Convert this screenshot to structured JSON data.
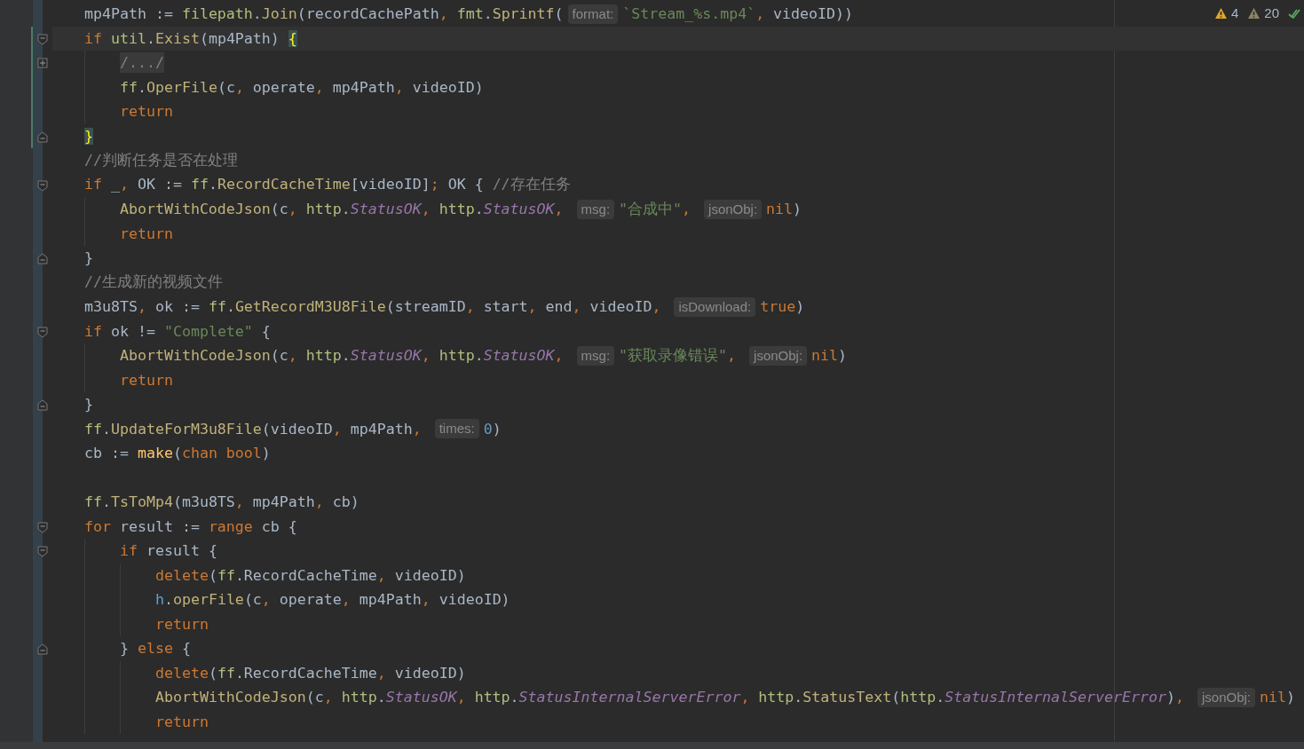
{
  "inspections": {
    "warnings": "4",
    "weak_warnings": "20",
    "ok": true
  },
  "lines": [
    {
      "current": false,
      "changed": false,
      "tokens": [
        {
          "kind": "id",
          "text": "mp4Path := "
        },
        {
          "kind": "pkg",
          "text": "filepath"
        },
        {
          "kind": "id",
          "text": "."
        },
        {
          "kind": "fn",
          "text": "Join"
        },
        {
          "kind": "id",
          "text": "(recordCachePath"
        },
        {
          "kind": "p",
          "text": ", "
        },
        {
          "kind": "pkg",
          "text": "fmt"
        },
        {
          "kind": "id",
          "text": "."
        },
        {
          "kind": "fn",
          "text": "Sprintf"
        },
        {
          "kind": "id",
          "text": "("
        },
        {
          "kind": "hint",
          "text": "format:"
        },
        {
          "kind": "str",
          "text": "`Stream_%s.mp4`"
        },
        {
          "kind": "p",
          "text": ", "
        },
        {
          "kind": "id",
          "text": "videoID))"
        }
      ]
    },
    {
      "current": true,
      "changed": true,
      "fold_marker": {
        "kind": "start"
      },
      "tokens": [
        {
          "kind": "kw",
          "text": "if "
        },
        {
          "kind": "pkg",
          "text": "util"
        },
        {
          "kind": "id",
          "text": "."
        },
        {
          "kind": "fn",
          "text": "Exist"
        },
        {
          "kind": "id",
          "text": "(mp4Path) "
        },
        {
          "kind": "brace",
          "text": "{"
        }
      ]
    },
    {
      "current": false,
      "changed": true,
      "fold_marker": {
        "kind": "collapsed"
      },
      "tokens": [
        {
          "kind": "folded",
          "text": "    /.../"
        }
      ]
    },
    {
      "current": false,
      "changed": true,
      "tokens": [
        {
          "kind": "pkg",
          "text": "    ff"
        },
        {
          "kind": "id",
          "text": "."
        },
        {
          "kind": "fn",
          "text": "OperFile"
        },
        {
          "kind": "id",
          "text": "(c"
        },
        {
          "kind": "p",
          "text": ", "
        },
        {
          "kind": "id",
          "text": "operate"
        },
        {
          "kind": "p",
          "text": ", "
        },
        {
          "kind": "id",
          "text": "mp4Path"
        },
        {
          "kind": "p",
          "text": ", "
        },
        {
          "kind": "id",
          "text": "videoID)"
        }
      ]
    },
    {
      "current": false,
      "changed": true,
      "tokens": [
        {
          "kind": "kw",
          "text": "    return"
        }
      ]
    },
    {
      "current": false,
      "changed": true,
      "fold_marker": {
        "kind": "end"
      },
      "tokens": [
        {
          "kind": "brace",
          "text": "}"
        }
      ]
    },
    {
      "current": false,
      "changed": false,
      "tokens": [
        {
          "kind": "cm",
          "text": "//判断任务是否在处理"
        }
      ]
    },
    {
      "current": false,
      "changed": false,
      "fold_marker": {
        "kind": "start"
      },
      "tokens": [
        {
          "kind": "kw",
          "text": "if "
        },
        {
          "kind": "id",
          "text": "_"
        },
        {
          "kind": "p",
          "text": ", "
        },
        {
          "kind": "id",
          "text": "OK := "
        },
        {
          "kind": "pkg",
          "text": "ff"
        },
        {
          "kind": "id",
          "text": "."
        },
        {
          "kind": "fn",
          "text": "RecordCacheTime"
        },
        {
          "kind": "id",
          "text": "[videoID]"
        },
        {
          "kind": "p",
          "text": "; "
        },
        {
          "kind": "id",
          "text": "OK { "
        },
        {
          "kind": "cm",
          "text": "//存在任务"
        }
      ]
    },
    {
      "current": false,
      "changed": false,
      "tokens": [
        {
          "kind": "fn",
          "text": "    AbortWithCodeJson"
        },
        {
          "kind": "id",
          "text": "(c"
        },
        {
          "kind": "p",
          "text": ", "
        },
        {
          "kind": "pkg",
          "text": "http"
        },
        {
          "kind": "id",
          "text": "."
        },
        {
          "kind": "const",
          "text": "StatusOK"
        },
        {
          "kind": "p",
          "text": ", "
        },
        {
          "kind": "pkg",
          "text": "http"
        },
        {
          "kind": "id",
          "text": "."
        },
        {
          "kind": "const",
          "text": "StatusOK"
        },
        {
          "kind": "p",
          "text": ", "
        },
        {
          "kind": "hint",
          "text": "msg:"
        },
        {
          "kind": "str",
          "text": "\"合成中\""
        },
        {
          "kind": "p",
          "text": ", "
        },
        {
          "kind": "hint",
          "text": "jsonObj:"
        },
        {
          "kind": "kw",
          "text": "nil"
        },
        {
          "kind": "id",
          "text": ")"
        }
      ]
    },
    {
      "current": false,
      "changed": false,
      "tokens": [
        {
          "kind": "kw",
          "text": "    return"
        }
      ]
    },
    {
      "current": false,
      "changed": false,
      "fold_marker": {
        "kind": "end"
      },
      "tokens": [
        {
          "kind": "id",
          "text": "}"
        }
      ]
    },
    {
      "current": false,
      "changed": false,
      "tokens": [
        {
          "kind": "cm",
          "text": "//生成新的视频文件"
        }
      ]
    },
    {
      "current": false,
      "changed": false,
      "tokens": [
        {
          "kind": "id",
          "text": "m3u8TS"
        },
        {
          "kind": "p",
          "text": ", "
        },
        {
          "kind": "id",
          "text": "ok := "
        },
        {
          "kind": "pkg",
          "text": "ff"
        },
        {
          "kind": "id",
          "text": "."
        },
        {
          "kind": "fn",
          "text": "GetRecordM3U8File"
        },
        {
          "kind": "id",
          "text": "(streamID"
        },
        {
          "kind": "p",
          "text": ", "
        },
        {
          "kind": "id",
          "text": "start"
        },
        {
          "kind": "p",
          "text": ", "
        },
        {
          "kind": "id",
          "text": "end"
        },
        {
          "kind": "p",
          "text": ", "
        },
        {
          "kind": "id",
          "text": "videoID"
        },
        {
          "kind": "p",
          "text": ", "
        },
        {
          "kind": "hint",
          "text": "isDownload:"
        },
        {
          "kind": "kw",
          "text": "true"
        },
        {
          "kind": "id",
          "text": ")"
        }
      ]
    },
    {
      "current": false,
      "changed": false,
      "fold_marker": {
        "kind": "start"
      },
      "tokens": [
        {
          "kind": "kw",
          "text": "if "
        },
        {
          "kind": "id",
          "text": "ok != "
        },
        {
          "kind": "str",
          "text": "\"Complete\""
        },
        {
          "kind": "id",
          "text": " {"
        }
      ]
    },
    {
      "current": false,
      "changed": false,
      "tokens": [
        {
          "kind": "fn",
          "text": "    AbortWithCodeJson"
        },
        {
          "kind": "id",
          "text": "(c"
        },
        {
          "kind": "p",
          "text": ", "
        },
        {
          "kind": "pkg",
          "text": "http"
        },
        {
          "kind": "id",
          "text": "."
        },
        {
          "kind": "const",
          "text": "StatusOK"
        },
        {
          "kind": "p",
          "text": ", "
        },
        {
          "kind": "pkg",
          "text": "http"
        },
        {
          "kind": "id",
          "text": "."
        },
        {
          "kind": "const",
          "text": "StatusOK"
        },
        {
          "kind": "p",
          "text": ", "
        },
        {
          "kind": "hint",
          "text": "msg:"
        },
        {
          "kind": "str",
          "text": "\"获取录像错误\""
        },
        {
          "kind": "p",
          "text": ", "
        },
        {
          "kind": "hint",
          "text": "jsonObj:"
        },
        {
          "kind": "kw",
          "text": "nil"
        },
        {
          "kind": "id",
          "text": ")"
        }
      ]
    },
    {
      "current": false,
      "changed": false,
      "tokens": [
        {
          "kind": "kw",
          "text": "    return"
        }
      ]
    },
    {
      "current": false,
      "changed": false,
      "fold_marker": {
        "kind": "end"
      },
      "tokens": [
        {
          "kind": "id",
          "text": "}"
        }
      ]
    },
    {
      "current": false,
      "changed": false,
      "tokens": [
        {
          "kind": "pkg",
          "text": "ff"
        },
        {
          "kind": "id",
          "text": "."
        },
        {
          "kind": "fn",
          "text": "UpdateForM3u8File"
        },
        {
          "kind": "id",
          "text": "(videoID"
        },
        {
          "kind": "p",
          "text": ", "
        },
        {
          "kind": "id",
          "text": "mp4Path"
        },
        {
          "kind": "p",
          "text": ", "
        },
        {
          "kind": "hint",
          "text": "times:"
        },
        {
          "kind": "num",
          "text": "0"
        },
        {
          "kind": "id",
          "text": ")"
        }
      ]
    },
    {
      "current": false,
      "changed": false,
      "tokens": [
        {
          "kind": "id",
          "text": "cb := "
        },
        {
          "kind": "builtin",
          "text": "make"
        },
        {
          "kind": "id",
          "text": "("
        },
        {
          "kind": "kw",
          "text": "chan bool"
        },
        {
          "kind": "id",
          "text": ")"
        }
      ]
    },
    {
      "current": false,
      "changed": false
    },
    {
      "current": false,
      "changed": false,
      "tokens": [
        {
          "kind": "pkg",
          "text": "ff"
        },
        {
          "kind": "id",
          "text": "."
        },
        {
          "kind": "fn",
          "text": "TsToMp4"
        },
        {
          "kind": "id",
          "text": "(m3u8TS"
        },
        {
          "kind": "p",
          "text": ", "
        },
        {
          "kind": "id",
          "text": "mp4Path"
        },
        {
          "kind": "p",
          "text": ", "
        },
        {
          "kind": "id",
          "text": "cb)"
        }
      ]
    },
    {
      "current": false,
      "changed": false,
      "fold_marker": {
        "kind": "start"
      },
      "tokens": [
        {
          "kind": "kw",
          "text": "for "
        },
        {
          "kind": "id",
          "text": "result := "
        },
        {
          "kind": "kw",
          "text": "range "
        },
        {
          "kind": "id",
          "text": "cb {"
        }
      ]
    },
    {
      "current": false,
      "changed": false,
      "fold_marker": {
        "kind": "start"
      },
      "tokens": [
        {
          "kind": "kw",
          "text": "    if "
        },
        {
          "kind": "id",
          "text": "result {"
        }
      ]
    },
    {
      "current": false,
      "changed": false,
      "tokens": [
        {
          "kind": "kw",
          "text": "        delete"
        },
        {
          "kind": "id",
          "text": "("
        },
        {
          "kind": "pkg",
          "text": "ff"
        },
        {
          "kind": "id",
          "text": ".RecordCacheTime"
        },
        {
          "kind": "p",
          "text": ", "
        },
        {
          "kind": "id",
          "text": "videoID)"
        }
      ]
    },
    {
      "current": false,
      "changed": false,
      "tokens": [
        {
          "kind": "recv",
          "text": "        h"
        },
        {
          "kind": "id",
          "text": "."
        },
        {
          "kind": "fn",
          "text": "operFile"
        },
        {
          "kind": "id",
          "text": "(c"
        },
        {
          "kind": "p",
          "text": ", "
        },
        {
          "kind": "id",
          "text": "operate"
        },
        {
          "kind": "p",
          "text": ", "
        },
        {
          "kind": "id",
          "text": "mp4Path"
        },
        {
          "kind": "p",
          "text": ", "
        },
        {
          "kind": "id",
          "text": "videoID)"
        }
      ]
    },
    {
      "current": false,
      "changed": false,
      "tokens": [
        {
          "kind": "kw",
          "text": "        return"
        }
      ]
    },
    {
      "current": false,
      "changed": false,
      "fold_marker": {
        "kind": "end"
      },
      "tokens": [
        {
          "kind": "id",
          "text": "    } "
        },
        {
          "kind": "kw",
          "text": "else "
        },
        {
          "kind": "id",
          "text": "{"
        }
      ]
    },
    {
      "current": false,
      "changed": false,
      "tokens": [
        {
          "kind": "kw",
          "text": "        delete"
        },
        {
          "kind": "id",
          "text": "("
        },
        {
          "kind": "pkg",
          "text": "ff"
        },
        {
          "kind": "id",
          "text": ".RecordCacheTime"
        },
        {
          "kind": "p",
          "text": ", "
        },
        {
          "kind": "id",
          "text": "videoID)"
        }
      ]
    },
    {
      "current": false,
      "changed": false,
      "tokens": [
        {
          "kind": "fn",
          "text": "        AbortWithCodeJson"
        },
        {
          "kind": "id",
          "text": "(c"
        },
        {
          "kind": "p",
          "text": ", "
        },
        {
          "kind": "pkg",
          "text": "http"
        },
        {
          "kind": "id",
          "text": "."
        },
        {
          "kind": "const",
          "text": "StatusOK"
        },
        {
          "kind": "p",
          "text": ", "
        },
        {
          "kind": "pkg",
          "text": "http"
        },
        {
          "kind": "id",
          "text": "."
        },
        {
          "kind": "const",
          "text": "StatusInternalServerError"
        },
        {
          "kind": "p",
          "text": ", "
        },
        {
          "kind": "pkg",
          "text": "http"
        },
        {
          "kind": "id",
          "text": "."
        },
        {
          "kind": "fn",
          "text": "StatusText"
        },
        {
          "kind": "id",
          "text": "("
        },
        {
          "kind": "pkg",
          "text": "http"
        },
        {
          "kind": "id",
          "text": "."
        },
        {
          "kind": "const",
          "text": "StatusInternalServerError"
        },
        {
          "kind": "id",
          "text": ")"
        },
        {
          "kind": "p",
          "text": ", "
        },
        {
          "kind": "hint",
          "text": "jsonObj:"
        },
        {
          "kind": "kw",
          "text": "nil"
        },
        {
          "kind": "id",
          "text": ")"
        }
      ]
    },
    {
      "current": false,
      "changed": false,
      "tokens": [
        {
          "kind": "kw",
          "text": "        return"
        }
      ]
    }
  ]
}
